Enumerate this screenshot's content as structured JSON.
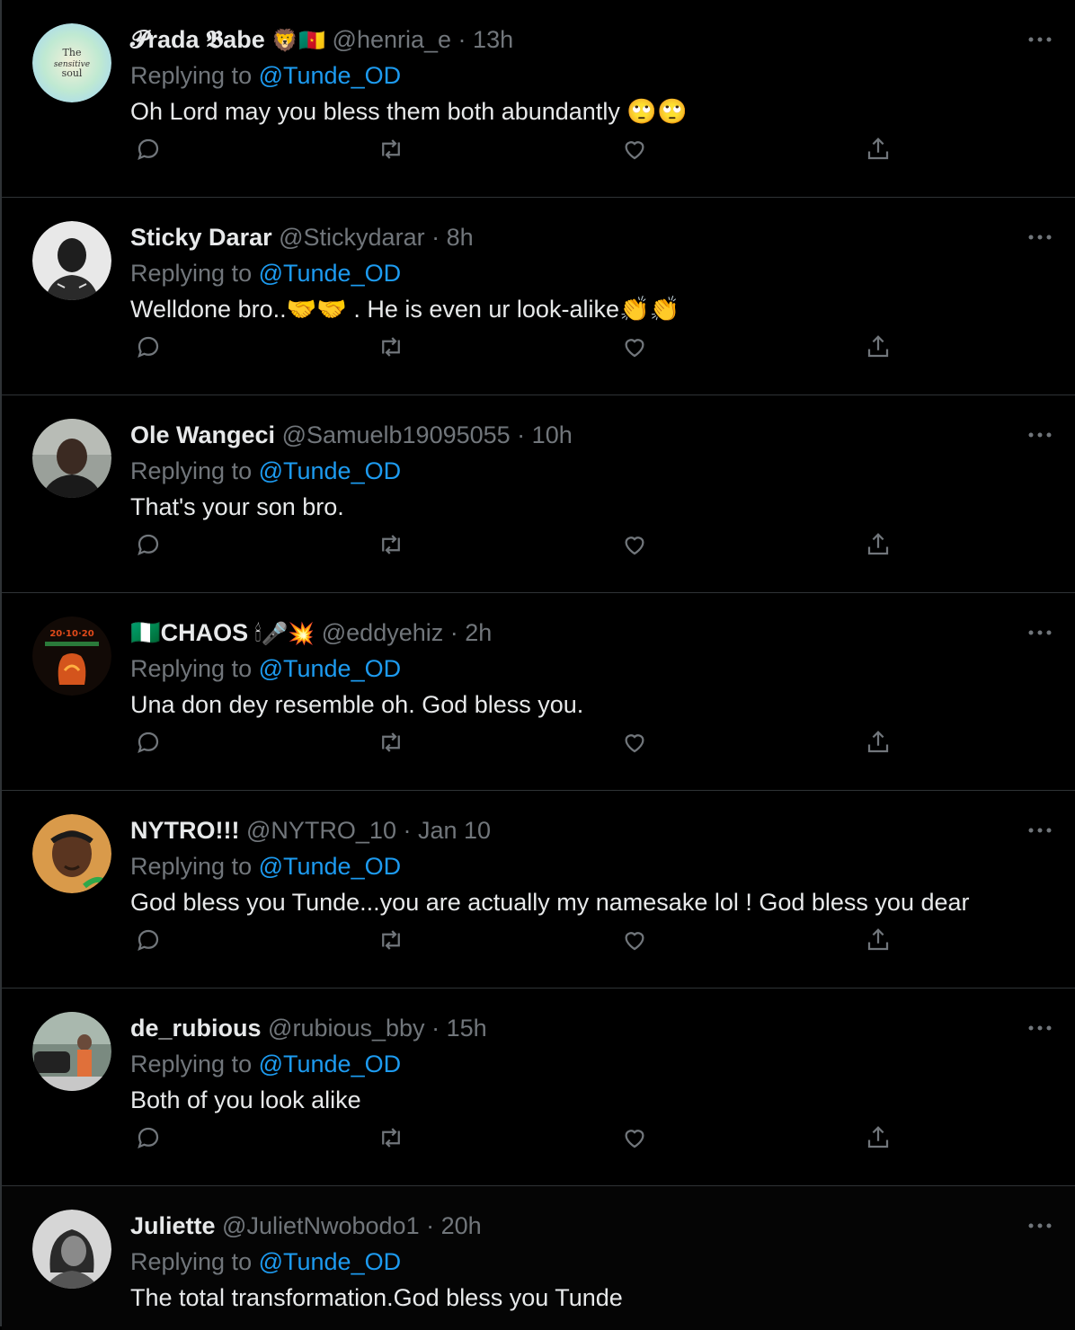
{
  "reply_prefix": "Replying to",
  "tweets": [
    {
      "name": "𝓟rada 𝕭abe",
      "emojis": "🦁🇨🇲",
      "handle": "@henria_e",
      "time": "13h",
      "replying_to": "@Tunde_OD",
      "text": "Oh Lord may you bless them both abundantly 🙄🙄",
      "avatar_color": "#bfe3c9",
      "avatar_text": "The sensitive soul"
    },
    {
      "name": "Sticky Darar",
      "emojis": "",
      "handle": "@Stickydarar",
      "time": "8h",
      "replying_to": "@Tunde_OD",
      "text": "Welldone  bro..🤝🤝 . He is even ur look-alike👏👏",
      "avatar_color": "#cfcfcf"
    },
    {
      "name": "Ole Wangeci",
      "emojis": "",
      "handle": "@Samuelb19095055",
      "time": "10h",
      "replying_to": "@Tunde_OD",
      "text": "That's your son bro.",
      "avatar_color": "#8a8f86"
    },
    {
      "name": "🇳🇬CHAOS",
      "emojis": "🕯🎤💥",
      "handle": "@eddyehiz",
      "time": "2h",
      "replying_to": "@Tunde_OD",
      "text": "Una don dey resemble oh. God bless you.",
      "avatar_color": "#1a0e08"
    },
    {
      "name": "NYTRO!!!",
      "emojis": "",
      "handle": "@NYTRO_10",
      "time": "Jan 10",
      "replying_to": "@Tunde_OD",
      "text": "God bless you Tunde...you are actually my namesake lol ! God bless you dear",
      "avatar_color": "#b07a3c"
    },
    {
      "name": "de_rubious",
      "emojis": "",
      "handle": "@rubious_bby",
      "time": "15h",
      "replying_to": "@Tunde_OD",
      "text": "Both of you look alike",
      "avatar_color": "#5a6a62"
    },
    {
      "name": "Juliette",
      "emojis": "",
      "handle": "@JulietNwobodo1",
      "time": "20h",
      "replying_to": "@Tunde_OD",
      "text": "The total transformation.God bless you Tunde",
      "avatar_color": "#9a9a9a"
    }
  ]
}
